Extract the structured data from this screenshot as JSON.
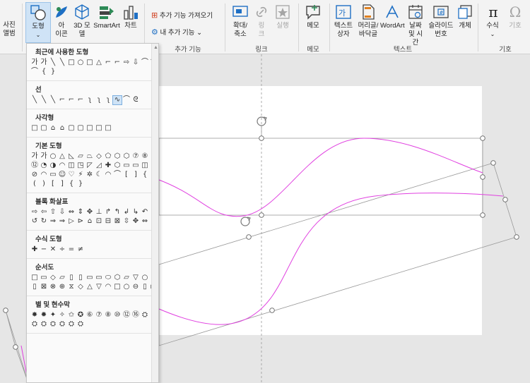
{
  "ribbon": {
    "photo_album": "사진\n앨범",
    "shapes": "도형",
    "icons": "아\n이콘",
    "models3d": "3D 모\n델",
    "smartart": "SmartArt",
    "chart": "차트",
    "get_addins": "추가 기능 가져오기",
    "my_addins": "내 추가 기능",
    "addins_group": "추가 기능",
    "zoom": "확대/\n축소",
    "link": "링\n크",
    "action": "실행",
    "links_group": "링크",
    "comment": "메모",
    "comments_group": "메모",
    "textbox": "텍스트\n상자",
    "header_footer": "머리글/\n바닥글",
    "wordart": "WordArt",
    "datetime": "날짜\n및 시간",
    "slide_number": "슬라이드\n번호",
    "object": "개체",
    "text_group": "텍스트",
    "equation": "수식",
    "symbol": "기호",
    "symbols_group": "기호"
  },
  "dropdown": {
    "sections": [
      {
        "title": "최근에 사용한 도형",
        "shapes": [
          "가",
          "가",
          "╲",
          "╲",
          "□",
          "○",
          "□",
          "△",
          "⌐",
          "⌐",
          "⇨",
          "⇩",
          "⌒",
          "⌒",
          "⌒",
          "{",
          "}"
        ]
      },
      {
        "title": "선",
        "shapes": [
          "╲",
          "╲",
          "╲",
          "⌐",
          "⌐",
          "⌐",
          "ʅ",
          "ʅ",
          "ʅ",
          "∿",
          "⌒",
          "ᘓ"
        ]
      },
      {
        "title": "사각형",
        "shapes": [
          "□",
          "▢",
          "⌂",
          "⌂",
          "▢",
          "▢",
          "□",
          "□",
          "□"
        ]
      },
      {
        "title": "기본 도형",
        "shapes": [
          "가",
          "가",
          "○",
          "△",
          "◺",
          "▱",
          "⏢",
          "◇",
          "⬠",
          "⬡",
          "⬡",
          "⑦",
          "⑧",
          "⑩",
          "⑫",
          "◔",
          "◑",
          "◠",
          "◫",
          "◳",
          "◸",
          "◿",
          "✚",
          "⬡",
          "▭",
          "▭",
          "◫",
          "◎",
          "⊘",
          "◠",
          "▭",
          "☺",
          "♡",
          "⚡",
          "✲",
          "☾",
          "◠",
          "⌒",
          "[",
          "]",
          "{",
          "}",
          "(",
          ")",
          "[",
          "]",
          "{",
          "}"
        ]
      },
      {
        "title": "블록 화살표",
        "shapes": [
          "⇨",
          "⇦",
          "⇧",
          "⇩",
          "⇔",
          "⇕",
          "✥",
          "⊥",
          "↱",
          "↰",
          "↲",
          "↳",
          "↶",
          "↷",
          "↺",
          "↻",
          "⇒",
          "⇒",
          "▷",
          "⊳",
          "⌂",
          "⊡",
          "⊟",
          "⊠",
          "⇳",
          "✥",
          "⇔"
        ]
      },
      {
        "title": "수식 도형",
        "shapes": [
          "✚",
          "−",
          "✕",
          "÷",
          "=",
          "≠"
        ]
      },
      {
        "title": "순서도",
        "shapes": [
          "□",
          "▭",
          "◇",
          "▱",
          "▯",
          "▯",
          "▭",
          "▭",
          "⬭",
          "⬡",
          "▱",
          "▽",
          "○",
          "□",
          "▯",
          "⊠",
          "⊗",
          "⊕",
          "⧖",
          "◇",
          "△",
          "▽",
          "◠",
          "□",
          "○",
          "⊖",
          "▯",
          "◯"
        ]
      },
      {
        "title": "별 및 현수막",
        "shapes": [
          "✸",
          "✹",
          "✦",
          "✧",
          "✩",
          "✪",
          "⑥",
          "⑦",
          "⑧",
          "⑩",
          "⑫",
          "⑯",
          "⛭",
          "⛭",
          "⛭",
          "⛭",
          "⛭",
          "⛭",
          "⛭",
          "⛭"
        ]
      }
    ]
  },
  "colors": {
    "accent": "#1e6fc4",
    "curve": "#e040e0",
    "ribbon_bg": "#f3f3f3"
  }
}
